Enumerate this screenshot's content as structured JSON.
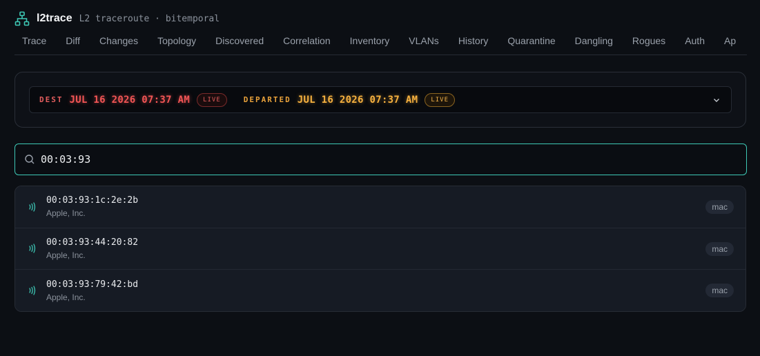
{
  "header": {
    "app_name": "l2trace",
    "subtitle": "L2 traceroute · bitemporal"
  },
  "tabs": [
    "Trace",
    "Diff",
    "Changes",
    "Topology",
    "Discovered",
    "Correlation",
    "Inventory",
    "VLANs",
    "History",
    "Quarantine",
    "Dangling",
    "Rogues",
    "Auth",
    "Ap"
  ],
  "time": {
    "dest_label": "DEST",
    "dest_value": "JUL 16 2026 07:37 AM",
    "dest_badge": "LIVE",
    "departed_label": "DEPARTED",
    "departed_value": "JUL 16 2026 07:37 AM",
    "departed_badge": "LIVE"
  },
  "search": {
    "value": "00:03:93"
  },
  "results": [
    {
      "mac": "00:03:93:1c:2e:2b",
      "vendor": "Apple, Inc.",
      "type": "mac"
    },
    {
      "mac": "00:03:93:44:20:82",
      "vendor": "Apple, Inc.",
      "type": "mac"
    },
    {
      "mac": "00:03:93:79:42:bd",
      "vendor": "Apple, Inc.",
      "type": "mac"
    }
  ],
  "colors": {
    "accent": "#3ec9b6",
    "dest": "#f25555",
    "departed": "#f6b13f",
    "background": "#0c0f14"
  },
  "icons": {
    "brand": "network-tree-icon",
    "search": "search-icon",
    "expand": "chevron-down-icon",
    "result": "wireless-signal-icon"
  }
}
